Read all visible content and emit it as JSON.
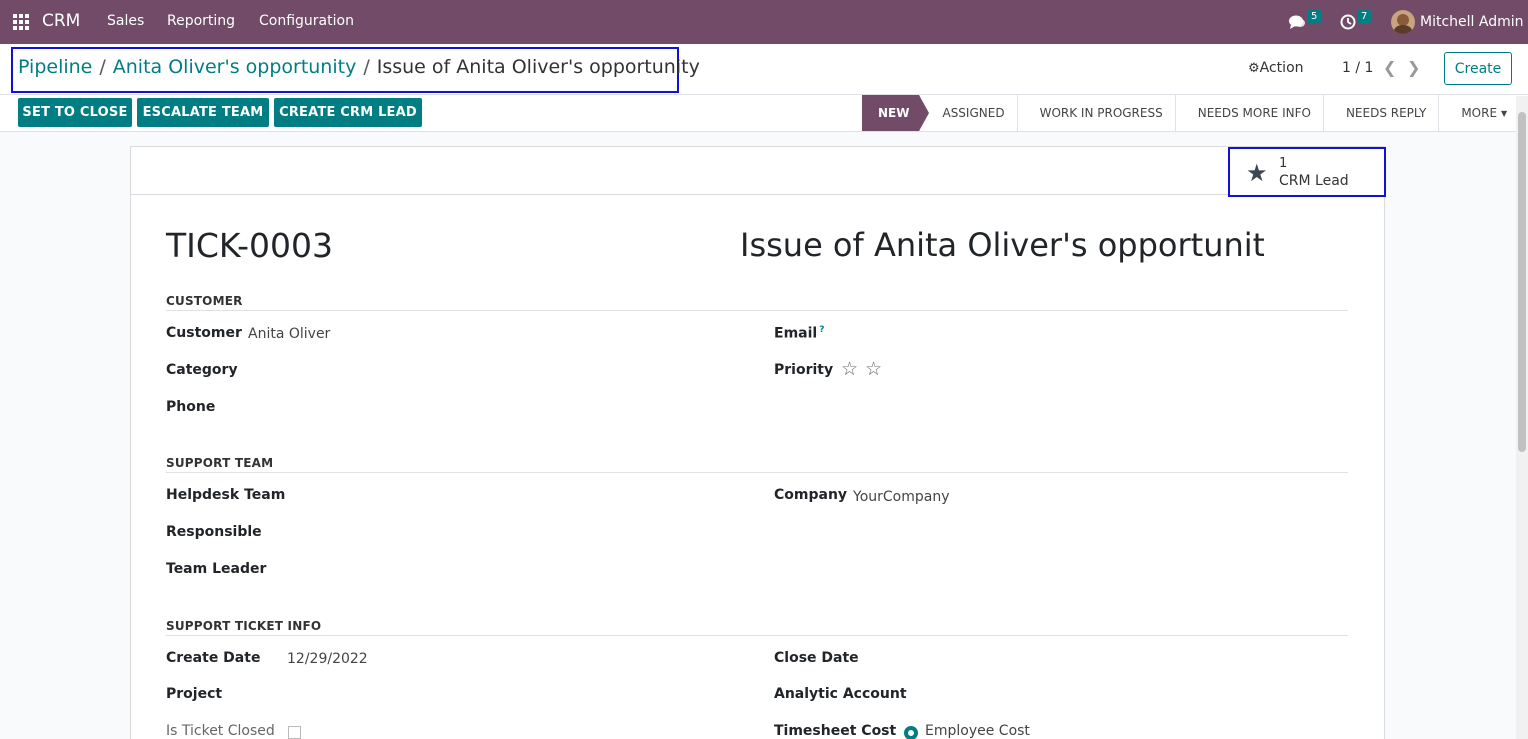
{
  "navbar": {
    "app_name": "CRM",
    "menus": [
      "Sales",
      "Reporting",
      "Configuration"
    ],
    "messages_count": "5",
    "activities_count": "7",
    "user_name": "Mitchell Admin"
  },
  "breadcrumb": {
    "items": [
      "Pipeline",
      "Anita Oliver's opportunity"
    ],
    "separator": "/",
    "current": "Issue of Anita Oliver's opportunity"
  },
  "control": {
    "action_label": "Action",
    "pager": "1 / 1",
    "create_label": "Create"
  },
  "header_buttons": [
    "SET TO CLOSE",
    "ESCALATE TEAM",
    "CREATE CRM LEAD"
  ],
  "stages": {
    "items": [
      "NEW",
      "ASSIGNED",
      "WORK IN PROGRESS",
      "NEEDS MORE INFO",
      "NEEDS REPLY"
    ],
    "active": "NEW",
    "more_label": "MORE"
  },
  "smart_button": {
    "count": "1",
    "label": "CRM Lead",
    "icon": "star-icon"
  },
  "ticket": {
    "reference": "TICK-0003",
    "name": "Issue of Anita Oliver's opportunity"
  },
  "sections": {
    "customer": {
      "title": "CUSTOMER",
      "customer_label": "Customer",
      "customer_value": "Anita Oliver",
      "category_label": "Category",
      "phone_label": "Phone",
      "email_label": "Email",
      "email_help": "?",
      "priority_label": "Priority",
      "priority_stars": 0
    },
    "support_team": {
      "title": "SUPPORT TEAM",
      "helpdesk_team_label": "Helpdesk Team",
      "responsible_label": "Responsible",
      "team_leader_label": "Team Leader",
      "company_label": "Company",
      "company_value": "YourCompany"
    },
    "ticket_info": {
      "title": "SUPPORT TICKET INFO",
      "create_date_label": "Create Date",
      "create_date_value": "12/29/2022",
      "project_label": "Project",
      "is_closed_label": "Is Ticket Closed",
      "close_date_label": "Close Date",
      "analytic_account_label": "Analytic Account",
      "timesheet_cost_label": "Timesheet Cost",
      "timesheet_cost_value": "Employee Cost"
    }
  },
  "colors": {
    "brand": "#714b67",
    "accent": "#017e84",
    "highlight": "#1010d8"
  }
}
